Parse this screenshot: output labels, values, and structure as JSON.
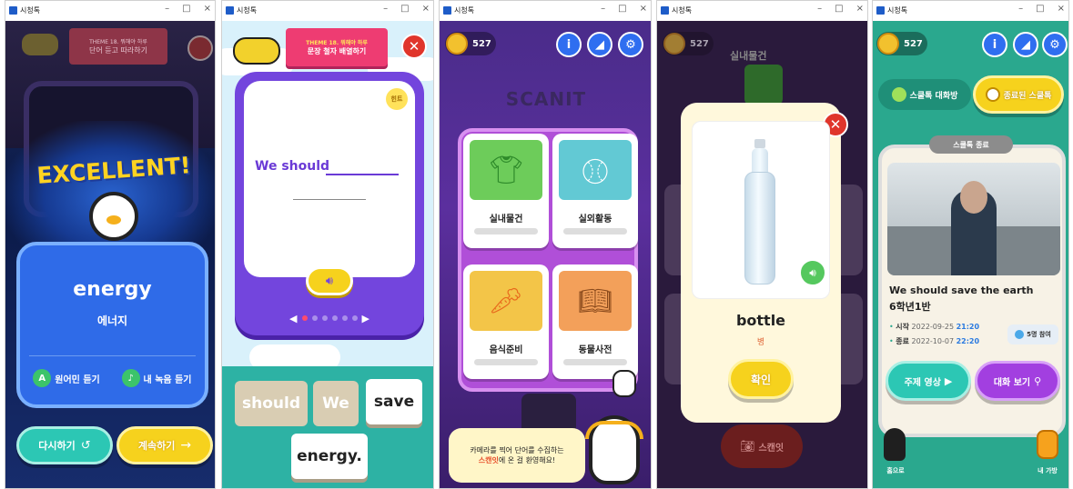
{
  "window_title": "시청톡",
  "controls": [
    "–",
    "□",
    "×"
  ],
  "panel1": {
    "banner_line1": "THEME 18. 뭐해야 하루",
    "banner_line2": "단어 듣고 따라하기",
    "title": "EXCELLENT!",
    "word": "energy",
    "meaning": "에너지",
    "native_label": "원어민 듣기",
    "my_label": "내 녹음 듣기",
    "retry_label": "다시하기",
    "continue_label": "계속하기"
  },
  "panel2": {
    "banner_line1": "THEME 18. 뭐해야 하루",
    "banner_line2": "문장 철자 배열하기",
    "hint": "힌트",
    "sentence": "We should",
    "tiles": [
      "should",
      "We",
      "save",
      "energy."
    ]
  },
  "panel3": {
    "coins": "527",
    "logo": "SCANIT",
    "cards": [
      "실내물건",
      "실외활동",
      "음식준비",
      "동물사전"
    ],
    "bubble_line1": "카메라를 찍어 단어를 수집하는",
    "bubble_highlight": "스캔잇",
    "bubble_line2": "에 온 걸 환영해요!"
  },
  "panel4": {
    "coins": "527",
    "bg_title": "실내물건",
    "word": "bottle",
    "meaning": "병",
    "confirm_label": "확인",
    "scan_label": "스캔잇"
  },
  "panel5": {
    "coins": "527",
    "tab_chat": "스쿨톡 대화방",
    "tab_done": "종료된 스쿨톡",
    "card_tag": "스쿨톡 종료",
    "title": "We should save the earth",
    "class_name": "6학년1반",
    "start_label": "시작",
    "start_date": "2022-09-25",
    "start_time": "21:20",
    "end_label": "종료",
    "end_date": "2022-10-07",
    "end_time": "22:20",
    "participants": "5명 참여",
    "video_label": "주제 영상",
    "view_label": "대화 보기",
    "home_label": "홈으로",
    "bag_label": "내 가방"
  },
  "colors": {
    "accent_blue": "#2f6ef0",
    "teal": "#25b9aa",
    "yellow": "#f5d21c",
    "purple": "#7b3fe0",
    "red": "#e0352b"
  }
}
